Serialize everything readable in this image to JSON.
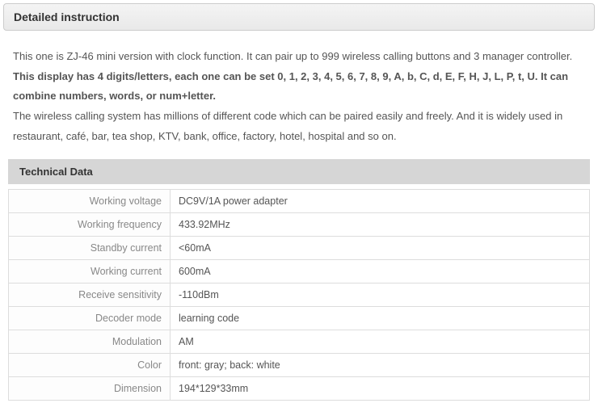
{
  "header": {
    "title": "Detailed instruction"
  },
  "description": {
    "p1": "This one is ZJ-46 mini version with clock function. It can pair up to 999 wireless calling buttons and 3 manager controller.",
    "p2_bold": "This display has 4 digits/letters, each one can be set 0, 1, 2, 3, 4, 5, 6, 7, 8, 9, A, b, C, d, E, F, H, J, L, P, t, U. It can combine numbers, words, or num+letter.",
    "p3": "The wireless calling system has millions of different code which can be paired easily and freely. And it is widely used in restaurant, café, bar, tea shop, KTV, bank, office, factory, hotel, hospital and so on."
  },
  "tech_section_title": "Technical Data",
  "specs": [
    {
      "label": "Working voltage",
      "value": "DC9V/1A power adapter"
    },
    {
      "label": "Working frequency",
      "value": "433.92MHz"
    },
    {
      "label": "Standby current",
      "value": "<60mA"
    },
    {
      "label": "Working current",
      "value": "600mA"
    },
    {
      "label": "Receive sensitivity",
      "value": "-110dBm"
    },
    {
      "label": "Decoder mode",
      "value": "learning code"
    },
    {
      "label": "Modulation",
      "value": "AM"
    },
    {
      "label": "Color",
      "value": "front: gray; back: white"
    },
    {
      "label": "Dimension",
      "value": "194*129*33mm"
    }
  ]
}
